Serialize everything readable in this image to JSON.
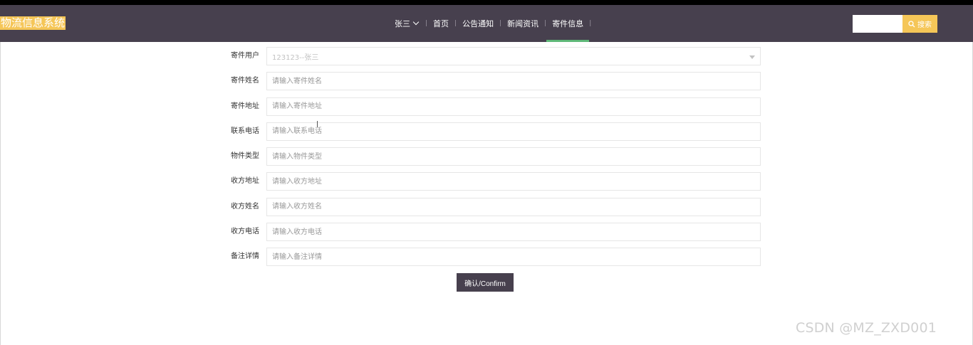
{
  "header": {
    "logo": "物流信息系统",
    "user": "张三",
    "nav": [
      {
        "label": "首页"
      },
      {
        "label": "公告通知"
      },
      {
        "label": "新闻资讯"
      },
      {
        "label": "寄件信息",
        "active": true
      }
    ],
    "search": {
      "value": "",
      "button_label": "搜索"
    }
  },
  "form": {
    "fields": [
      {
        "label": "寄件用户",
        "type": "select",
        "value": "123123--张三"
      },
      {
        "label": "寄件姓名",
        "placeholder": "请输入寄件姓名"
      },
      {
        "label": "寄件地址",
        "placeholder": "请输入寄件地址"
      },
      {
        "label": "联系电话",
        "placeholder": "请输入联系电话"
      },
      {
        "label": "物件类型",
        "placeholder": "请输入物件类型"
      },
      {
        "label": "收方地址",
        "placeholder": "请输入收方地址"
      },
      {
        "label": "收方姓名",
        "placeholder": "请输入收方姓名"
      },
      {
        "label": "收方电话",
        "placeholder": "请输入收方电话"
      },
      {
        "label": "备注详情",
        "placeholder": "请输入备注详情"
      }
    ],
    "confirm_label": "确认/Confirm"
  },
  "watermark": "CSDN @MZ_ZXD001",
  "colors": {
    "header_bg": "#47404e",
    "accent_yellow": "#f5c658",
    "active_underline": "#5fb878"
  }
}
